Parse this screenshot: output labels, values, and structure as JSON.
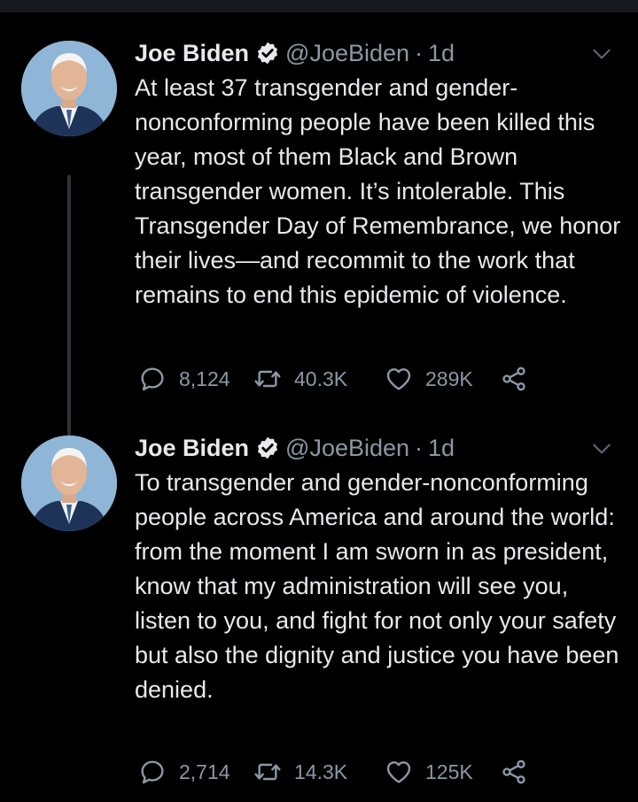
{
  "colors": {
    "background": "#000000",
    "text": "#e7e9ea",
    "muted": "#8b98a5",
    "verified": "#e7e9ea"
  },
  "tweets": [
    {
      "author": {
        "name": "Joe Biden",
        "handle": "@JoeBiden",
        "verified": true,
        "avatar": "profile-photo"
      },
      "separator": "·",
      "time": "1d",
      "text": "At least 37 transgender and gender-nonconforming people have been killed this year, most of them Black and Brown transgender women. It’s intolerable. This Transgender Day of Remembrance, we honor their lives—and recommit to the work that remains to end this epidemic of violence.",
      "stats": {
        "replies": "8,124",
        "retweets": "40.3K",
        "likes": "289K"
      }
    },
    {
      "author": {
        "name": "Joe Biden",
        "handle": "@JoeBiden",
        "verified": true,
        "avatar": "profile-photo"
      },
      "separator": "·",
      "time": "1d",
      "text": "To transgender and gender-nonconforming people across America and around the world: from the moment I am sworn in as president, know that my administration will see you, listen to you, and fight for not only your safety but also the dignity and justice you have been denied.",
      "stats": {
        "replies": "2,714",
        "retweets": "14.3K",
        "likes": "125K"
      }
    }
  ],
  "icons": [
    "reply-icon",
    "retweet-icon",
    "like-icon",
    "share-icon",
    "verified-icon",
    "caret-down-icon"
  ]
}
